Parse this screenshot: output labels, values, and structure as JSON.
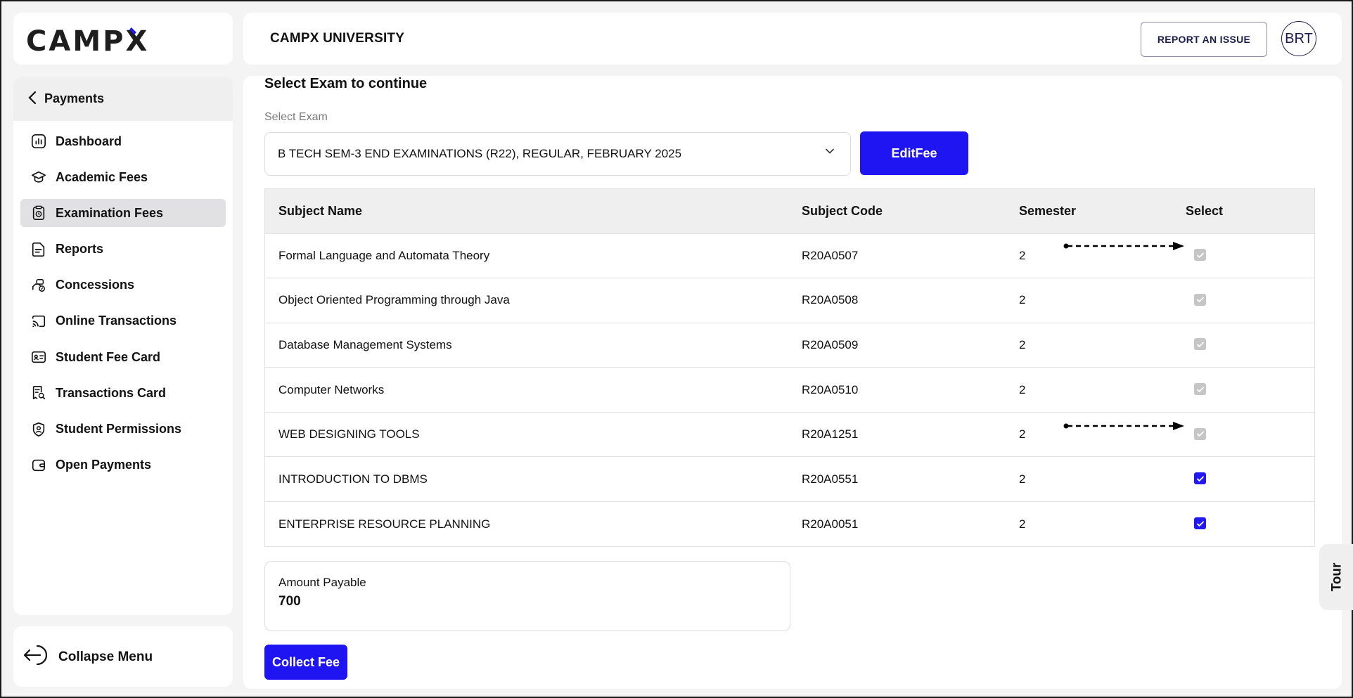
{
  "brand": {
    "logo_text": "CAMPX"
  },
  "header": {
    "title": "CAMPX UNIVERSITY",
    "report_button": "REPORT AN ISSUE",
    "avatar_initials": "BRT"
  },
  "sidebar": {
    "back_label": "Payments",
    "items": [
      {
        "label": "Dashboard",
        "icon": "dashboard-icon"
      },
      {
        "label": "Academic Fees",
        "icon": "graduation-cap-icon"
      },
      {
        "label": "Examination Fees",
        "icon": "clipboard-clock-icon",
        "active": true
      },
      {
        "label": "Reports",
        "icon": "document-icon"
      },
      {
        "label": "Concessions",
        "icon": "discount-icon"
      },
      {
        "label": "Online Transactions",
        "icon": "cast-icon"
      },
      {
        "label": "Student Fee Card",
        "icon": "id-card-icon"
      },
      {
        "label": "Transactions Card",
        "icon": "receipt-search-icon"
      },
      {
        "label": "Student Permissions",
        "icon": "user-shield-icon"
      },
      {
        "label": "Open Payments",
        "icon": "wallet-icon"
      }
    ],
    "collapse_label": "Collapse Menu"
  },
  "main": {
    "section_title": "Select Exam to continue",
    "select_label": "Select Exam",
    "selected_exam": "B TECH SEM-3 END EXAMINATIONS (R22), REGULAR, FEBRUARY 2025",
    "edit_button": "EditFee",
    "table": {
      "headers": [
        "Subject Name",
        "Subject Code",
        "Semester",
        "Select"
      ],
      "rows": [
        {
          "name": "Formal Language and Automata Theory",
          "code": "R20A0507",
          "semester": "2",
          "checked": true,
          "disabled": true
        },
        {
          "name": "Object Oriented Programming through Java",
          "code": "R20A0508",
          "semester": "2",
          "checked": true,
          "disabled": true
        },
        {
          "name": "Database Management Systems",
          "code": "R20A0509",
          "semester": "2",
          "checked": true,
          "disabled": true
        },
        {
          "name": "Computer Networks",
          "code": "R20A0510",
          "semester": "2",
          "checked": true,
          "disabled": true
        },
        {
          "name": "WEB DESIGNING TOOLS",
          "code": "R20A1251",
          "semester": "2",
          "checked": true,
          "disabled": true
        },
        {
          "name": "INTRODUCTION TO DBMS",
          "code": "R20A0551",
          "semester": "2",
          "checked": true,
          "disabled": false
        },
        {
          "name": "ENTERPRISE RESOURCE PLANNING",
          "code": "R20A0051",
          "semester": "2",
          "checked": true,
          "disabled": false
        }
      ]
    },
    "amount_label": "Amount Payable",
    "amount_value": "700",
    "collect_button": "Collect Fee"
  },
  "tour_label": "Tour",
  "colors": {
    "accent": "#1f14f2",
    "disabled_checkbox": "#c6c6c6",
    "active_nav": "#e1e1e4"
  }
}
